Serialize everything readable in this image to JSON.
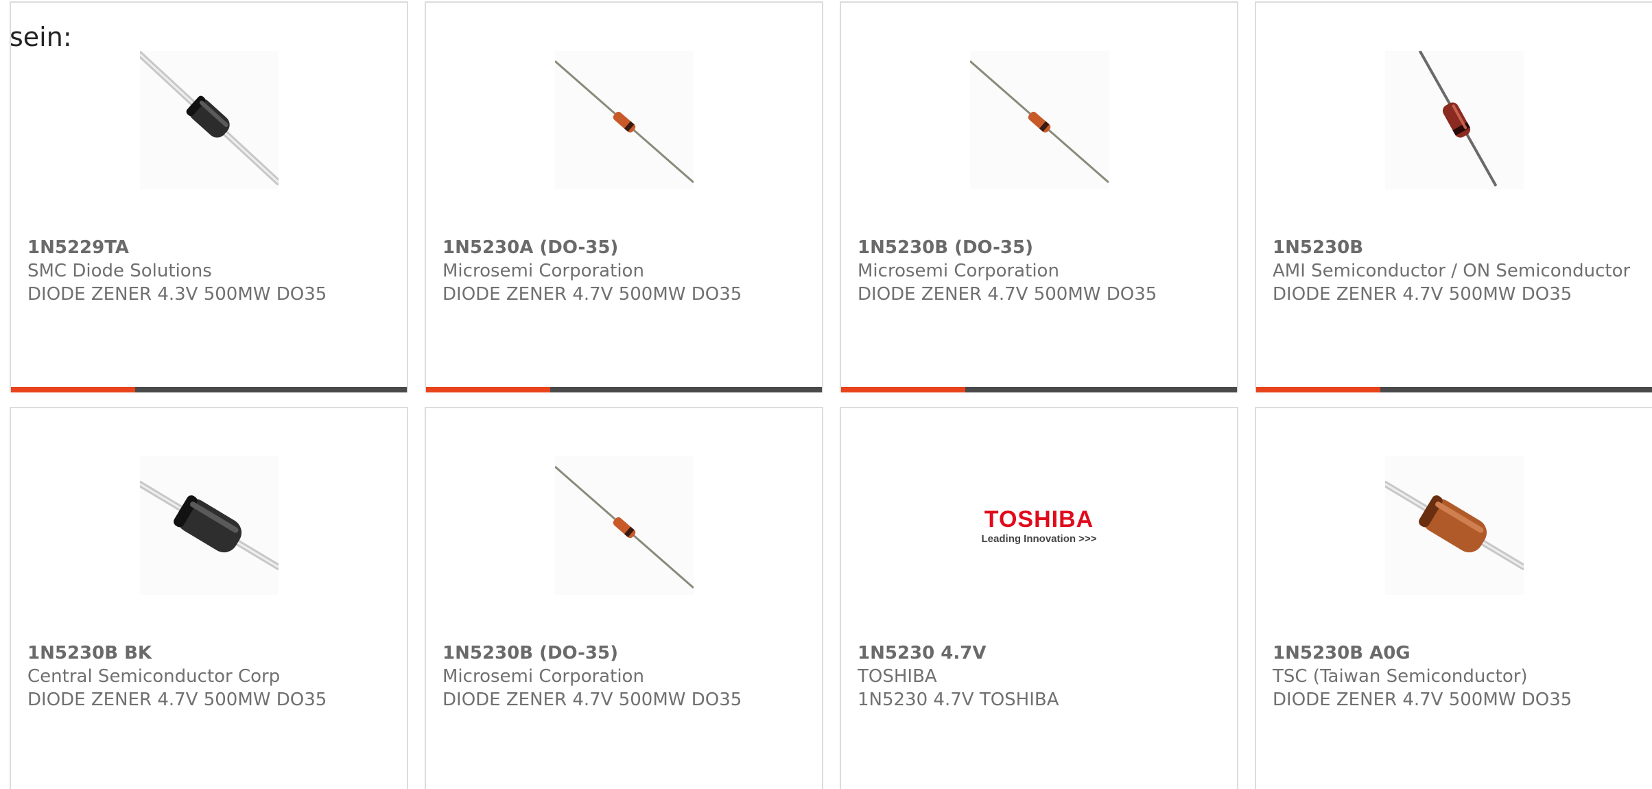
{
  "intro_text": "sein:",
  "products": [
    {
      "part": "1N5229TA",
      "maker": "SMC Diode Solutions",
      "desc": "DIODE ZENER 4.3V 500MW DO35",
      "image": "black-glass-diode"
    },
    {
      "part": "1N5230A (DO-35)",
      "maker": "Microsemi Corporation",
      "desc": "DIODE ZENER 4.7V 500MW DO35",
      "image": "orange-axial-diode"
    },
    {
      "part": "1N5230B (DO-35)",
      "maker": "Microsemi Corporation",
      "desc": "DIODE ZENER 4.7V 500MW DO35",
      "image": "orange-axial-diode"
    },
    {
      "part": "1N5230B",
      "maker": "AMI Semiconductor / ON Semiconductor",
      "desc": "DIODE ZENER 4.7V 500MW DO35",
      "image": "red-glass-diode"
    },
    {
      "part": "1N5230B BK",
      "maker": "Central Semiconductor Corp",
      "desc": "DIODE ZENER 4.7V 500MW DO35",
      "image": "black-glass-diode"
    },
    {
      "part": "1N5230B (DO-35)",
      "maker": "Microsemi Corporation",
      "desc": "DIODE ZENER 4.7V 500MW DO35",
      "image": "orange-axial-diode"
    },
    {
      "part": "1N5230 4.7V",
      "maker": "TOSHIBA",
      "desc": "1N5230 4.7V TOSHIBA",
      "image": "toshiba-logo"
    },
    {
      "part": "1N5230B A0G",
      "maker": "TSC (Taiwan Semiconductor)",
      "desc": "DIODE ZENER 4.7V 500MW DO35",
      "image": "brown-glass-diode"
    }
  ],
  "toshiba_logo": {
    "brand": "TOSHIBA",
    "tagline": "Leading Innovation >>>"
  },
  "colors": {
    "accent": "#e8431a",
    "bar": "#4a4a4a",
    "border": "#dcdcdc",
    "text": "#707070",
    "toshiba_red": "#e00b1c"
  }
}
